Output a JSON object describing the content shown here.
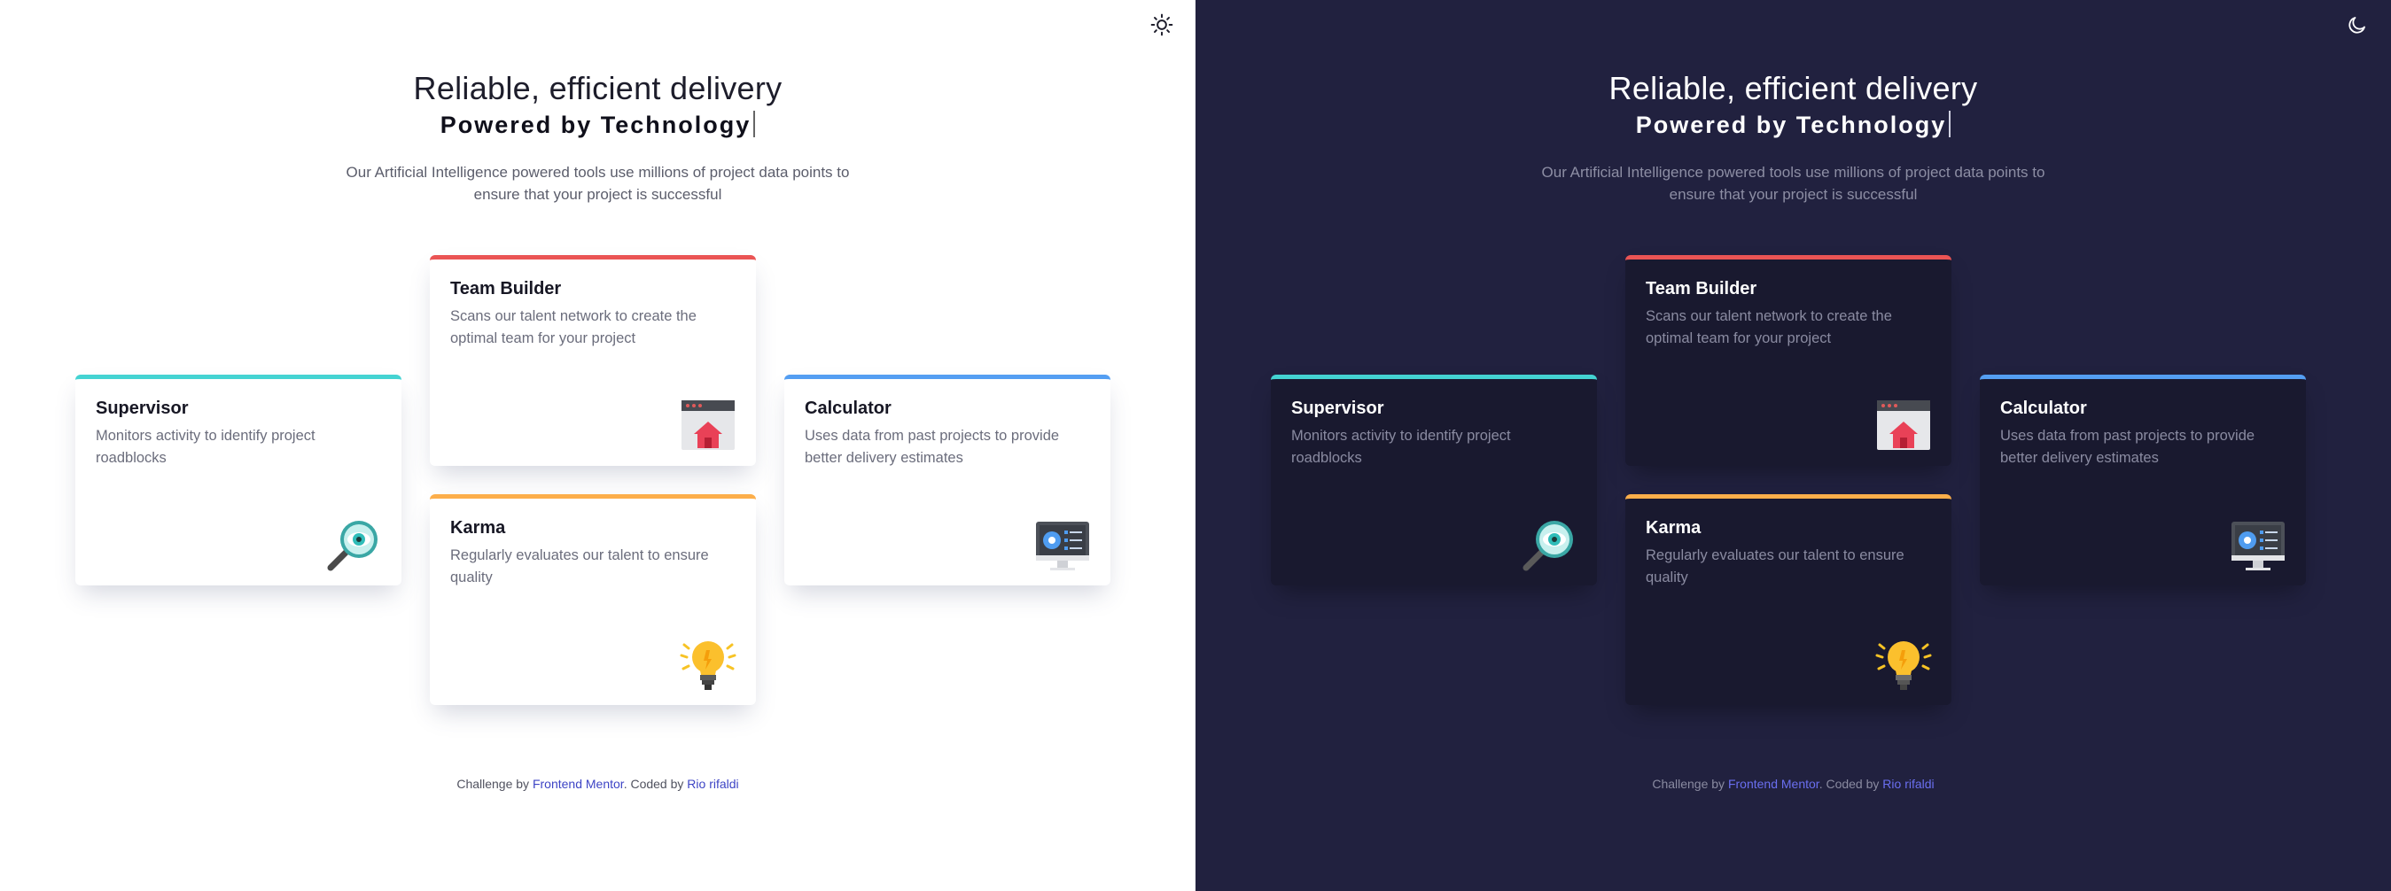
{
  "hero": {
    "title": "Reliable, efficient delivery",
    "subtitle": "Powered by Technology",
    "description": "Our Artificial Intelligence powered tools use millions of project data points to ensure that your project is successful"
  },
  "theme_toggle": {
    "light_icon": "sun-icon",
    "dark_icon": "moon-icon"
  },
  "cards": [
    {
      "title": "Supervisor",
      "description": "Monitors activity to identify project roadblocks",
      "icon": "magnifier-icon",
      "accent": "#44d3d2"
    },
    {
      "title": "Team Builder",
      "description": "Scans our talent network to create the optimal team for your project",
      "icon": "team-builder-icon",
      "accent": "#ea5454"
    },
    {
      "title": "Karma",
      "description": "Regularly evaluates our talent to ensure quality",
      "icon": "lightbulb-icon",
      "accent": "#fcae4a"
    },
    {
      "title": "Calculator",
      "description": "Uses data from past projects to provide better delivery estimates",
      "icon": "calculator-monitor-icon",
      "accent": "#549ef2"
    }
  ],
  "footer": {
    "prefix": "Challenge by ",
    "challenge_link": "Frontend Mentor",
    "middle": ". Coded by ",
    "author_link": "Rio rifaldi"
  },
  "colors": {
    "light_background": "#ffffff",
    "dark_background": "#21213f",
    "dark_card": "#19192f"
  }
}
